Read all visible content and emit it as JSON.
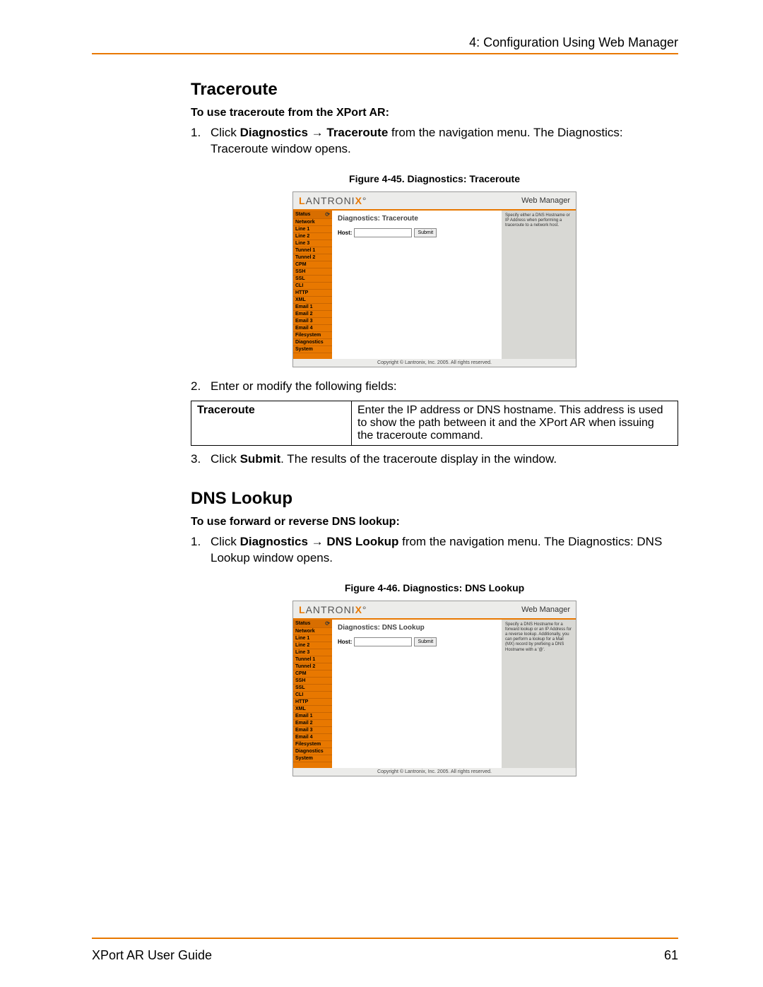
{
  "header": {
    "chapter_title": "4: Configuration Using Web Manager"
  },
  "traceroute": {
    "title": "Traceroute",
    "subtitle": "To use traceroute from the XPort AR:",
    "step1_num": "1.",
    "step1_pre": "Click ",
    "step1_path_a": "Diagnostics",
    "step1_arrow": " → ",
    "step1_path_b": "Traceroute",
    "step1_post": " from the navigation menu. The Diagnostics: Traceroute window opens.",
    "figure_caption": "Figure 4-45. Diagnostics: Traceroute",
    "step2_num": "2.",
    "step2_text": "Enter or modify the following fields:",
    "field_label": "Traceroute",
    "field_desc": "Enter the IP address or DNS hostname.  This address is used to show the path between it and the XPort AR when issuing the traceroute command.",
    "step3_num": "3.",
    "step3_pre": "Click ",
    "step3_bold": "Submit",
    "step3_post": ". The results of the traceroute display in the window."
  },
  "dnslookup": {
    "title": "DNS Lookup",
    "subtitle": "To use forward or reverse DNS lookup:",
    "step1_num": "1.",
    "step1_pre": "Click ",
    "step1_path_a": "Diagnostics",
    "step1_arrow": " → ",
    "step1_path_b": "DNS Lookup",
    "step1_post": " from the navigation menu. The Diagnostics: DNS Lookup window opens.",
    "figure_caption": "Figure 4-46. Diagnostics: DNS Lookup"
  },
  "screenshot_common": {
    "logo_text": "ANTRONI",
    "webmanager": "Web Manager",
    "host_label": "Host:",
    "submit_label": "Submit",
    "copyright": "Copyright © Lantronix, Inc. 2005. All rights reserved.",
    "nav_items": [
      "Status",
      "Network",
      "Line 1",
      "Line 2",
      "Line 3",
      "Tunnel 1",
      "Tunnel 2",
      "CPM",
      "SSH",
      "SSL",
      "CLI",
      "HTTP",
      "XML",
      "Email 1",
      "Email 2",
      "Email 3",
      "Email 4",
      "Filesystem",
      "Diagnostics",
      "System"
    ]
  },
  "shot_traceroute": {
    "panel_title": "Diagnostics: Traceroute",
    "help_text": "Specify either a DNS Hostname or IP Address when performing a traceroute to a network host."
  },
  "shot_dns": {
    "panel_title": "Diagnostics: DNS Lookup",
    "help_text": "Specify a DNS Hostname for a forward lookup or an IP Address for a reverse lookup. Additionally, you can perform a lookup for a Mail (MX) record by prefixing a DNS Hostname with a '@'."
  },
  "footer": {
    "guide": "XPort AR User Guide",
    "page": "61"
  }
}
